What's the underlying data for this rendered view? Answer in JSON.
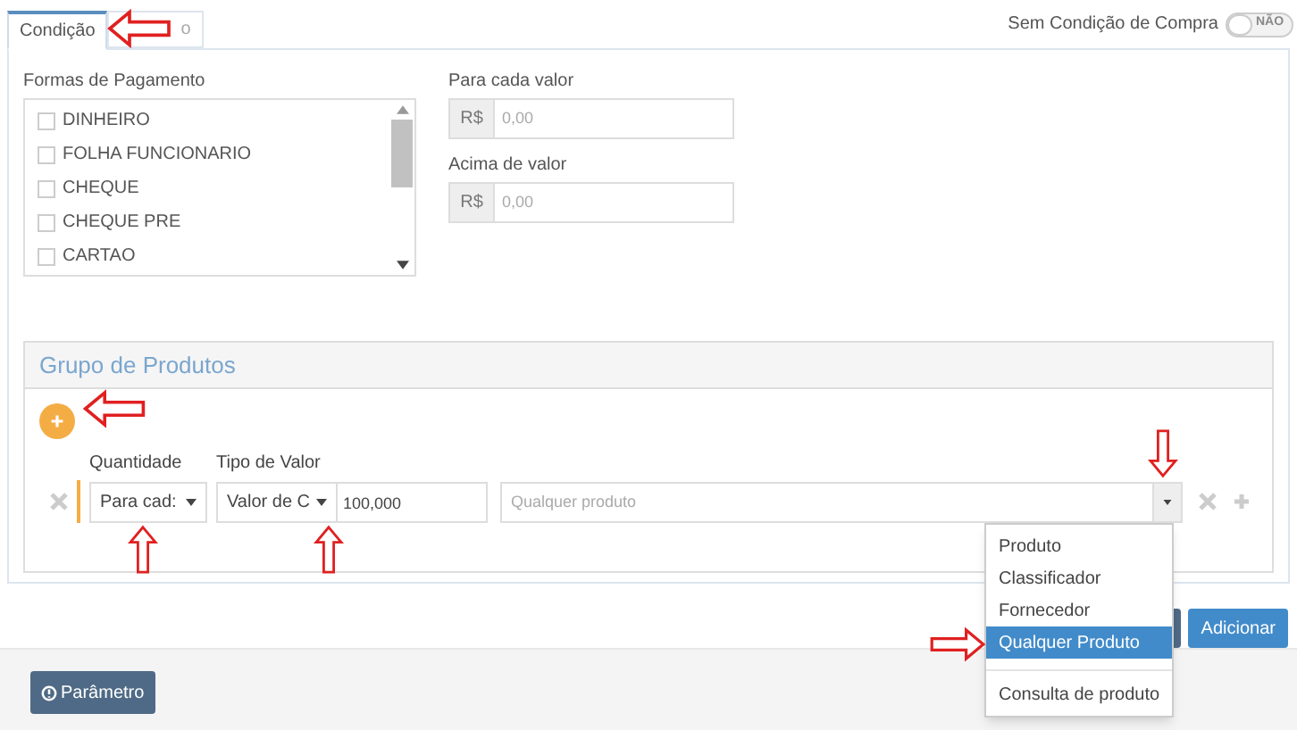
{
  "tabs": [
    {
      "label": "Condição",
      "selected": true
    },
    {
      "label": "o",
      "selected": false
    }
  ],
  "toggle": {
    "label": "Sem Condição de Compra",
    "on": false,
    "state_text": "NÃO"
  },
  "payment_methods": {
    "label": "Formas de Pagamento",
    "items": [
      {
        "label": "DINHEIRO",
        "checked": false
      },
      {
        "label": "FOLHA FUNCIONARIO",
        "checked": false
      },
      {
        "label": "CHEQUE",
        "checked": false
      },
      {
        "label": "CHEQUE PRE",
        "checked": false
      },
      {
        "label": "CARTAO",
        "checked": false
      }
    ]
  },
  "value_fields": [
    {
      "label": "Para cada valor",
      "prefix": "R$",
      "placeholder": "0,00"
    },
    {
      "label": "Acima de valor",
      "prefix": "R$",
      "placeholder": "0,00"
    }
  ],
  "product_group": {
    "title": "Grupo de Produtos",
    "quantity": {
      "label": "Quantidade",
      "value": "Para cad:"
    },
    "value_type": {
      "label": "Tipo de Valor",
      "value": "Valor de C",
      "amount": "100,000"
    },
    "product": {
      "placeholder": "Qualquer produto"
    },
    "menu": [
      {
        "label": "Produto",
        "selected": false,
        "kind": "item"
      },
      {
        "label": "Classificador",
        "selected": false,
        "kind": "item"
      },
      {
        "label": "Fornecedor",
        "selected": false,
        "kind": "item"
      },
      {
        "label": "Qualquer Produto",
        "selected": true,
        "kind": "item"
      },
      {
        "label": "Consulta de produto",
        "selected": false,
        "kind": "divided"
      }
    ]
  },
  "buttons": {
    "add": "Adicionar",
    "parameter": "Parâmetro"
  }
}
